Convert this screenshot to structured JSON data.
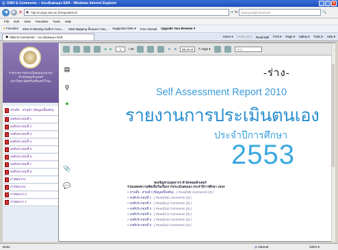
{
  "window": {
    "title": "SWU E-Comments :: ประเมินตนเอง SAR - Windows Internet Explorer"
  },
  "address": {
    "url": "http://cospp.swu.ac.th/regulations/",
    "search_placeholder": "www.google-fixed.net"
  },
  "menu": [
    "File",
    "Edit",
    "View",
    "Favorites",
    "Tools",
    "Help"
  ],
  "favorites": {
    "label": "Favorites",
    "items": [
      "SWU E-Meeting บันทึกการประ...",
      "Mind Mapping ทั้งหมดการพบ...",
      "Suggested Sites ▾",
      "Free Hotmail",
      "Upgrade Your Browser ▾"
    ]
  },
  "tab": {
    "label": "SWU E-Comments :: ประเมินตนเอง SAR"
  },
  "command_bar": [
    "Home ▾",
    "Feeds (J) ▾",
    "Read Mail",
    "Print ▾",
    "Page ▾",
    "Safety ▾",
    "Tools ▾",
    "Help ▾"
  ],
  "sidebar": {
    "title": "รายงานการประเมินตนเอง(SAR)",
    "subtitle1": "สำนักคอมพิวเตอร์",
    "subtitle2": "มหาวิทยาลัยศรีนครินทรวิโรฒ",
    "items": [
      "ส่วนที่1 : ส่วนนำ (ข้อมูลเบื้องต้น)",
      "องค์ประกอบที่ 1",
      "องค์ประกอบที่ 2",
      "องค์ประกอบที่ 3",
      "องค์ประกอบที่ 4",
      "องค์ประกอบที่ 5",
      "องค์ประกอบที่ 6",
      "องค์ประกอบที่ 7",
      "องค์ประกอบที่ 8",
      "ภาคผนวก1",
      "ภาคผนวก2",
      "ภาคผนวก 3",
      "ภาคผนวก 4"
    ]
  },
  "pdf_toolbar": {
    "page": "1",
    "total": "/ 29",
    "zoom": "85.1% ▾",
    "sign": "Sign ▾",
    "find_placeholder": "Find"
  },
  "document": {
    "draft": "-ร่าง-",
    "title_en": "Self Assessment Report 2010",
    "title_th": "รายงานการประเมินตนเอง",
    "year_label": "ประจำปีการศึกษา",
    "year": "2553"
  },
  "info": {
    "line1": "ขอเชิญชวนบุคลากร สำนักคอมพิวเตอร์",
    "line2": "ร่วมแสดงความคิดเห็นในเรื่องการประเมินตนเอง ประจำปีการศึกษา 2553"
  },
  "links": [
    {
      "label": "ส่วนที่1 : ส่วนนำ (ข้อมูลเบื้องต้น)",
      "meta": "- [ Read(39) Comments (0) ]"
    },
    {
      "label": "องค์ประกอบที่ 1",
      "meta": "- [ Read(38) Comments (0) ]"
    },
    {
      "label": "องค์ประกอบที่ 2",
      "meta": "- [ Read(12) Comments (0) ]"
    },
    {
      "label": "องค์ประกอบที่ 3",
      "meta": "- [ Read(16) Comments (0) ]"
    },
    {
      "label": "องค์ประกอบที่ 4",
      "meta": "- [ Read(17) Comments (0) ]"
    },
    {
      "label": "องค์ประกอบที่ 5",
      "meta": "- [ Read(15) Comments (0) ]"
    },
    {
      "label": "องค์ประกอบที่ 6",
      "meta": "- [ Read(11) Comments (0) ]"
    }
  ],
  "status": {
    "left": "Done",
    "zone": "Internet",
    "zoom": "100% ▾"
  }
}
